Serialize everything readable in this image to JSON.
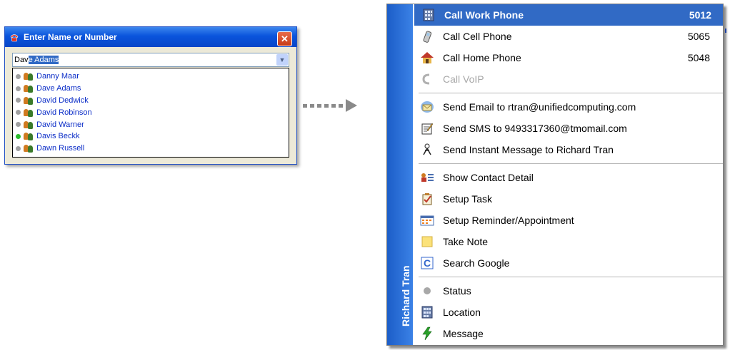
{
  "dialog": {
    "title": "Enter Name or Number",
    "input_typed": "Dav",
    "input_selected": "e Adams",
    "contacts": [
      {
        "name": "Danny Maar",
        "status": "offline"
      },
      {
        "name": "Dave Adams",
        "status": "offline"
      },
      {
        "name": "David Dedwick",
        "status": "offline"
      },
      {
        "name": "David Robinson",
        "status": "offline"
      },
      {
        "name": "David Warner",
        "status": "offline"
      },
      {
        "name": "Davis Beckk",
        "status": "online"
      },
      {
        "name": "Dawn Russell",
        "status": "offline"
      }
    ]
  },
  "menu": {
    "contact_name": "Richard Tran",
    "call_items": [
      {
        "label": "Call Work Phone",
        "number": "5012",
        "icon": "building-icon"
      },
      {
        "label": "Call Cell Phone",
        "number": "5065",
        "icon": "cellphone-icon"
      },
      {
        "label": "Call Home Phone",
        "number": "5048",
        "icon": "house-icon"
      },
      {
        "label": "Call VoIP",
        "number": "",
        "icon": "voip-icon"
      }
    ],
    "message_items": [
      {
        "label": "Send Email to rtran@unifiedcomputing.com",
        "icon": "email-icon"
      },
      {
        "label": "Send SMS to 9493317360@tmomail.com",
        "icon": "sms-icon"
      },
      {
        "label": "Send Instant Message to Richard Tran",
        "icon": "instant-message-icon"
      }
    ],
    "tool_items": [
      {
        "label": "Show Contact Detail",
        "icon": "contact-card-icon"
      },
      {
        "label": "Setup Task",
        "icon": "task-icon"
      },
      {
        "label": "Setup Reminder/Appointment",
        "icon": "calendar-icon"
      },
      {
        "label": "Take Note",
        "icon": "note-icon"
      },
      {
        "label": "Search Google",
        "icon": "google-icon"
      }
    ],
    "info_items": [
      {
        "label": "Status",
        "icon": "status-dot-icon"
      },
      {
        "label": "Location",
        "icon": "building-icon"
      },
      {
        "label": "Message",
        "icon": "lightning-icon"
      }
    ]
  }
}
